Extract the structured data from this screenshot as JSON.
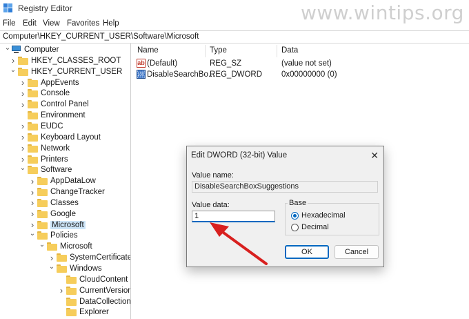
{
  "window": {
    "title": "Registry Editor"
  },
  "watermark": "www.wintips.org",
  "menu": [
    "File",
    "Edit",
    "View",
    "Favorites",
    "Help"
  ],
  "address": "Computer\\HKEY_CURRENT_USER\\Software\\Microsoft",
  "tree": [
    {
      "label": "Computer",
      "icon": "computer-icon",
      "chevron": "down"
    },
    {
      "label": "HKEY_CLASSES_ROOT",
      "icon": "folder-icon",
      "chevron": "right"
    },
    {
      "label": "HKEY_CURRENT_USER",
      "icon": "folder-icon",
      "chevron": "down"
    },
    {
      "label": "AppEvents",
      "icon": "folder-icon",
      "chevron": "right"
    },
    {
      "label": "Console",
      "icon": "folder-icon",
      "chevron": "right"
    },
    {
      "label": "Control Panel",
      "icon": "folder-icon",
      "chevron": "right"
    },
    {
      "label": "Environment",
      "icon": "folder-icon",
      "chevron": "none"
    },
    {
      "label": "EUDC",
      "icon": "folder-icon",
      "chevron": "right"
    },
    {
      "label": "Keyboard Layout",
      "icon": "folder-icon",
      "chevron": "right"
    },
    {
      "label": "Network",
      "icon": "folder-icon",
      "chevron": "right"
    },
    {
      "label": "Printers",
      "icon": "folder-icon",
      "chevron": "right"
    },
    {
      "label": "Software",
      "icon": "folder-icon",
      "chevron": "down"
    },
    {
      "label": "AppDataLow",
      "icon": "folder-icon",
      "chevron": "right"
    },
    {
      "label": "ChangeTracker",
      "icon": "folder-icon",
      "chevron": "right"
    },
    {
      "label": "Classes",
      "icon": "folder-icon",
      "chevron": "right"
    },
    {
      "label": "Google",
      "icon": "folder-icon",
      "chevron": "right"
    },
    {
      "label": "Microsoft",
      "icon": "folder-icon",
      "chevron": "right",
      "selected": true
    },
    {
      "label": "Policies",
      "icon": "folder-icon",
      "chevron": "down"
    },
    {
      "label": "Microsoft",
      "icon": "folder-icon",
      "chevron": "down"
    },
    {
      "label": "SystemCertificates",
      "icon": "folder-icon",
      "chevron": "right"
    },
    {
      "label": "Windows",
      "icon": "folder-icon",
      "chevron": "down"
    },
    {
      "label": "CloudContent",
      "icon": "folder-icon",
      "chevron": "none"
    },
    {
      "label": "CurrentVersion",
      "icon": "folder-icon",
      "chevron": "right"
    },
    {
      "label": "DataCollection",
      "icon": "folder-icon",
      "chevron": "none"
    },
    {
      "label": "Explorer",
      "icon": "folder-icon",
      "chevron": "none"
    }
  ],
  "list": {
    "columns": [
      "Name",
      "Type",
      "Data"
    ],
    "rows": [
      {
        "name": "(Default)",
        "type": "REG_SZ",
        "data": "(value not set)",
        "icon": "string-value-icon"
      },
      {
        "name": "DisableSearchBo...",
        "type": "REG_DWORD",
        "data": "0x00000000 (0)",
        "icon": "binary-value-icon"
      }
    ]
  },
  "dialog": {
    "title": "Edit DWORD (32-bit) Value",
    "value_name_label": "Value name:",
    "value_name": "DisableSearchBoxSuggestions",
    "value_data_label": "Value data:",
    "value_data": "1",
    "base_label": "Base",
    "base_options": [
      {
        "label": "Hexadecimal",
        "selected": true
      },
      {
        "label": "Decimal",
        "selected": false
      }
    ],
    "ok_label": "OK",
    "cancel_label": "Cancel",
    "close_glyph": "✕"
  },
  "colors": {
    "arrow": "#d8201f",
    "accent": "#0067c0",
    "selection": "#cce4f7"
  }
}
